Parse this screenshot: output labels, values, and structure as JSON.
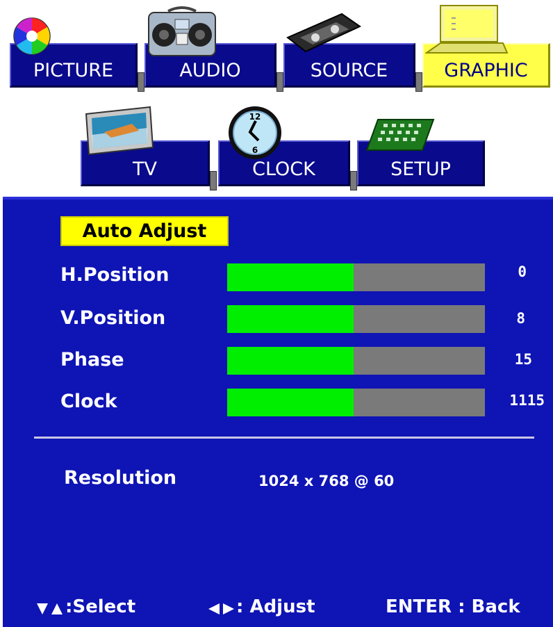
{
  "tabs": {
    "picture": "PICTURE",
    "audio": "AUDIO",
    "source": "SOURCE",
    "graphic": "GRAPHIC",
    "tv": "TV",
    "clock": "CLOCK",
    "setup": "SETUP"
  },
  "active_tab": "GRAPHIC",
  "clock_icon": {
    "top_number": "12",
    "bottom_number": "6"
  },
  "menu": {
    "auto_adjust": "Auto Adjust",
    "rows": [
      {
        "label": "H.Position",
        "value": "0",
        "level": 0.49
      },
      {
        "label": "V.Position",
        "value": "8",
        "level": 0.49
      },
      {
        "label": "Phase",
        "value": "15",
        "level": 0.49
      },
      {
        "label": "Clock",
        "value": "1115",
        "level": 0.49
      }
    ],
    "resolution_label": "Resolution",
    "resolution_value": "1024 x 768 @ 60"
  },
  "footer": {
    "select_label": ":Select",
    "adjust_label": ": Adjust",
    "back_label": "ENTER : Back"
  },
  "colors": {
    "panel_bg": "#0f14b4",
    "tab_bg": "#0a0a8c",
    "active_tab_bg": "#ffff4a",
    "bar_fill": "#00ee00",
    "bar_track": "#7a7a7a",
    "highlight": "#ffff00"
  },
  "icons": [
    "color-wheel-icon",
    "boombox-icon",
    "vhs-tape-icon",
    "computer-icon",
    "tv-set-icon",
    "clock-icon",
    "keypad-icon",
    "down-arrow-icon",
    "up-arrow-icon",
    "left-arrow-icon",
    "right-arrow-icon"
  ]
}
